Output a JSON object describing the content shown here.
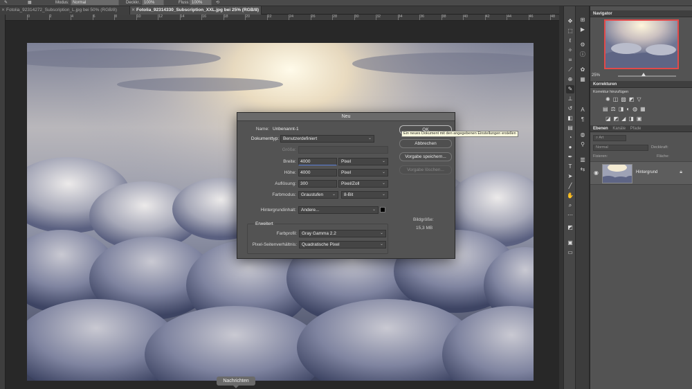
{
  "options_bar": {
    "mode_label": "Modus:",
    "mode_value": "Normal",
    "opacity_label": "Deckkr.:",
    "opacity_value": "100%",
    "flow_label": "Fluss:",
    "flow_value": "100%"
  },
  "tabs": [
    {
      "label": "Fotolia_92314272_Subscription_L.jpg bei 50% (RGB/8)",
      "active": false
    },
    {
      "label": "Fotolia_92314330_Subscription_XXL.jpg bei 25% (RGB/8)",
      "active": true
    }
  ],
  "ruler_top_labels": [
    "0",
    "2",
    "4",
    "6",
    "8",
    "10",
    "12",
    "14",
    "16",
    "18",
    "20",
    "22",
    "24",
    "26",
    "28",
    "30",
    "32",
    "34",
    "36",
    "38",
    "40",
    "42",
    "44",
    "46",
    "48"
  ],
  "dialog": {
    "title": "Neu",
    "name_label": "Name:",
    "name_value": "Unbenannt-1",
    "doctype_label": "Dokumenttyp:",
    "doctype_value": "Benutzerdefiniert",
    "size_label": "Größe:",
    "width_label": "Breite:",
    "width_value": "4000",
    "width_unit": "Pixel",
    "height_label": "Höhe:",
    "height_value": "4000",
    "height_unit": "Pixel",
    "resolution_label": "Auflösung:",
    "resolution_value": "300",
    "resolution_unit": "Pixel/Zoll",
    "colormode_label": "Farbmodus:",
    "colormode_value": "Graustufen",
    "bitdepth_value": "8-Bit",
    "background_label": "Hintergrundinhalt:",
    "background_value": "Andere...",
    "advanced_label": "Erweitert",
    "profile_label": "Farbprofil:",
    "profile_value": "Gray Gamma 2.2",
    "pixel_aspect_label": "Pixel-Seitenverhältnis:",
    "pixel_aspect_value": "Quadratische Pixel",
    "ok_label": "OK",
    "cancel_label": "Abbrechen",
    "save_preset_label": "Vorgabe speichern...",
    "delete_preset_label": "Vorgabe löschen...",
    "image_size_label": "Bildgröße:",
    "image_size_value": "15,3 MB",
    "tooltip": "Ein neues Dokument mit den angegebenen Einstellungen erstellen"
  },
  "notifications_label": "Nachrichten",
  "panels": {
    "navigator_title": "Navigator",
    "zoom_value": "25%",
    "corrections_title": "Korrekturen",
    "corrections_hint": "Korrektur hinzufügen",
    "layers_title": "Ebenen",
    "channels_title": "Kanäle",
    "paths_title": "Pfade",
    "filter_placeholder": "Art",
    "blend_mode": "Normal",
    "opacity_label": "Deckkraft:",
    "lock_label": "Fixieren:",
    "fill_label": "Fläche:",
    "layer_name": "Hintergrund"
  }
}
